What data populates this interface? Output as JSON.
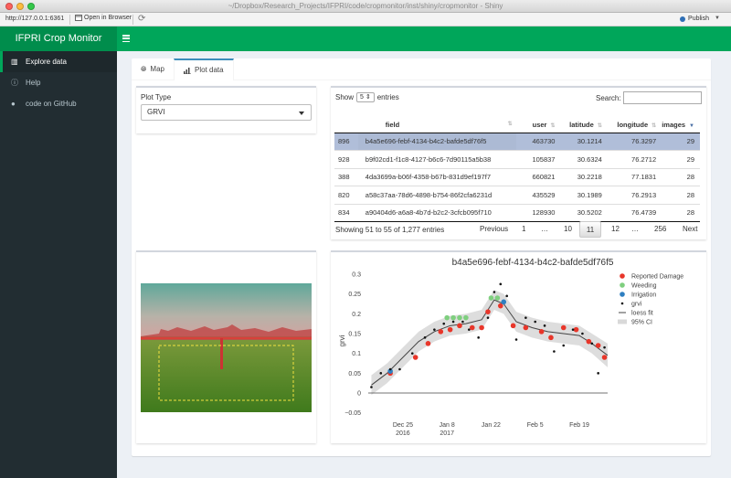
{
  "window": {
    "title": "~/Dropbox/Research_Projects/IFPRI/code/cropmonitor/inst/shiny/cropmonitor - Shiny",
    "url": "http://127.0.0.1:6361",
    "open_in_browser": "Open in Browser",
    "publish": "Publish"
  },
  "header": {
    "logo": "IFPRI Crop Monitor"
  },
  "sidebar": {
    "items": [
      {
        "label": "Explore data",
        "icon": "bar-chart-icon"
      },
      {
        "label": "Help",
        "icon": "info-circle-icon"
      },
      {
        "label": "code on GitHub",
        "icon": "github-icon"
      }
    ]
  },
  "tabs": [
    {
      "label": "Map",
      "icon": "globe-icon"
    },
    {
      "label": "Plot data",
      "icon": "bar-chart-icon"
    }
  ],
  "plot_type": {
    "label": "Plot Type",
    "value": "GRVI"
  },
  "table": {
    "show_label": "Show",
    "length_value": "5",
    "entries_label": "entries",
    "search_label": "Search:",
    "search_value": "",
    "headers": [
      "",
      "field",
      "user",
      "latitude",
      "longitude",
      "images"
    ],
    "rows": [
      [
        "896",
        "b4a5e696-febf-4134-b4c2-bafde5df76f5",
        "463730",
        "30.1214",
        "76.3297",
        "29"
      ],
      [
        "928",
        "b9f02cd1-f1c8-4127-b6c6-7d90115a5b38",
        "105837",
        "30.6324",
        "76.2712",
        "29"
      ],
      [
        "388",
        "4da3699a-b06f-4358-b67b-831d9ef197f7",
        "660821",
        "30.2218",
        "77.1831",
        "28"
      ],
      [
        "820",
        "a58c37aa-78d6-4898-b754-86f2cfa6231d",
        "435529",
        "30.1989",
        "76.2913",
        "28"
      ],
      [
        "834",
        "a90404d6-a6a8-4b7d-b2c2-3cfcb095f710",
        "128930",
        "30.5202",
        "76.4739",
        "28"
      ]
    ],
    "info": "Showing 51 to 55 of 1,277 entries",
    "pagination": [
      "Previous",
      "1",
      "…",
      "10",
      "11",
      "12",
      "…",
      "256",
      "Next"
    ],
    "current_page": "11"
  },
  "colors": {
    "header_green": "#00a65a",
    "logo_green": "#008d4c",
    "sidebar_dark": "#222d32",
    "selected_row": "#b0bed9",
    "reported_damage": "#e8362a",
    "weeding": "#7fcf7f",
    "irrigation": "#2f7fc1",
    "grvi": "#111111",
    "loess": "#444444",
    "ci_band": "#d9d9d9"
  },
  "chart_data": {
    "type": "scatter",
    "title": "b4a5e696-febf-4134-b4c2-bafde5df76f5",
    "xlabel": "",
    "ylabel": "grvi",
    "x_ticks": [
      "Dec 25\n2016",
      "Jan 8\n2017",
      "Jan 22",
      "Feb 5",
      "Feb 19"
    ],
    "x_tick_dates": [
      "2016-12-25",
      "2017-01-08",
      "2017-01-22",
      "2017-02-05",
      "2017-02-19"
    ],
    "x_range": [
      "2016-12-14",
      "2017-02-28"
    ],
    "y_ticks": [
      -0.05,
      0,
      0.05,
      0.1,
      0.15,
      0.2,
      0.25,
      0.3
    ],
    "ylim": [
      -0.06,
      0.3
    ],
    "legend": [
      "Reported Damage",
      "Weeding",
      "Irrigation",
      "grvi",
      "loess fit",
      "95% CI"
    ],
    "legend_placement": "right",
    "series": [
      {
        "name": "Reported Damage",
        "marker": "circle",
        "points": [
          [
            "2016-12-21",
            0.05
          ],
          [
            "2016-12-29",
            0.09
          ],
          [
            "2017-01-02",
            0.125
          ],
          [
            "2017-01-06",
            0.155
          ],
          [
            "2017-01-09",
            0.16
          ],
          [
            "2017-01-12",
            0.17
          ],
          [
            "2017-01-16",
            0.165
          ],
          [
            "2017-01-19",
            0.165
          ],
          [
            "2017-01-21",
            0.205
          ],
          [
            "2017-01-25",
            0.22
          ],
          [
            "2017-01-29",
            0.17
          ],
          [
            "2017-02-02",
            0.165
          ],
          [
            "2017-02-07",
            0.155
          ],
          [
            "2017-02-10",
            0.14
          ],
          [
            "2017-02-14",
            0.165
          ],
          [
            "2017-02-18",
            0.16
          ],
          [
            "2017-02-22",
            0.13
          ],
          [
            "2017-02-25",
            0.12
          ],
          [
            "2017-02-27",
            0.09
          ]
        ]
      },
      {
        "name": "Weeding",
        "marker": "circle",
        "points": [
          [
            "2017-01-08",
            0.19
          ],
          [
            "2017-01-10",
            0.19
          ],
          [
            "2017-01-12",
            0.19
          ],
          [
            "2017-01-14",
            0.19
          ],
          [
            "2017-01-22",
            0.24
          ],
          [
            "2017-01-24",
            0.24
          ]
        ]
      },
      {
        "name": "Irrigation",
        "marker": "circle",
        "points": [
          [
            "2016-12-21",
            0.055
          ],
          [
            "2017-01-26",
            0.23
          ]
        ]
      },
      {
        "name": "grvi",
        "marker": "dot",
        "points": [
          [
            "2016-12-15",
            0.015
          ],
          [
            "2016-12-18",
            0.05
          ],
          [
            "2016-12-21",
            0.06
          ],
          [
            "2016-12-24",
            0.06
          ],
          [
            "2016-12-28",
            0.1
          ],
          [
            "2017-01-01",
            0.14
          ],
          [
            "2017-01-04",
            0.16
          ],
          [
            "2017-01-07",
            0.175
          ],
          [
            "2017-01-10",
            0.18
          ],
          [
            "2017-01-13",
            0.18
          ],
          [
            "2017-01-15",
            0.16
          ],
          [
            "2017-01-18",
            0.14
          ],
          [
            "2017-01-21",
            0.19
          ],
          [
            "2017-01-23",
            0.255
          ],
          [
            "2017-01-25",
            0.275
          ],
          [
            "2017-01-27",
            0.245
          ],
          [
            "2017-01-30",
            0.135
          ],
          [
            "2017-02-02",
            0.19
          ],
          [
            "2017-02-05",
            0.18
          ],
          [
            "2017-02-08",
            0.17
          ],
          [
            "2017-02-11",
            0.105
          ],
          [
            "2017-02-14",
            0.12
          ],
          [
            "2017-02-17",
            0.16
          ],
          [
            "2017-02-20",
            0.15
          ],
          [
            "2017-02-23",
            0.125
          ],
          [
            "2017-02-25",
            0.05
          ],
          [
            "2017-02-27",
            0.115
          ]
        ]
      },
      {
        "name": "loess fit",
        "marker": "line",
        "points": [
          [
            "2016-12-15",
            0.02
          ],
          [
            "2016-12-20",
            0.05
          ],
          [
            "2016-12-25",
            0.09
          ],
          [
            "2016-12-30",
            0.13
          ],
          [
            "2017-01-04",
            0.155
          ],
          [
            "2017-01-09",
            0.17
          ],
          [
            "2017-01-14",
            0.175
          ],
          [
            "2017-01-19",
            0.185
          ],
          [
            "2017-01-23",
            0.235
          ],
          [
            "2017-01-26",
            0.225
          ],
          [
            "2017-01-30",
            0.18
          ],
          [
            "2017-02-04",
            0.165
          ],
          [
            "2017-02-09",
            0.155
          ],
          [
            "2017-02-14",
            0.15
          ],
          [
            "2017-02-19",
            0.145
          ],
          [
            "2017-02-23",
            0.125
          ],
          [
            "2017-02-28",
            0.095
          ]
        ]
      },
      {
        "name": "95% CI",
        "marker": "band",
        "points": [
          [
            "2016-12-15",
            -0.005,
            0.045
          ],
          [
            "2016-12-20",
            0.025,
            0.075
          ],
          [
            "2016-12-25",
            0.065,
            0.115
          ],
          [
            "2016-12-30",
            0.105,
            0.155
          ],
          [
            "2017-01-04",
            0.13,
            0.18
          ],
          [
            "2017-01-09",
            0.145,
            0.195
          ],
          [
            "2017-01-14",
            0.15,
            0.2
          ],
          [
            "2017-01-19",
            0.16,
            0.21
          ],
          [
            "2017-01-23",
            0.21,
            0.26
          ],
          [
            "2017-01-26",
            0.2,
            0.25
          ],
          [
            "2017-01-30",
            0.155,
            0.205
          ],
          [
            "2017-02-04",
            0.14,
            0.19
          ],
          [
            "2017-02-09",
            0.13,
            0.18
          ],
          [
            "2017-02-14",
            0.125,
            0.175
          ],
          [
            "2017-02-19",
            0.12,
            0.17
          ],
          [
            "2017-02-23",
            0.1,
            0.15
          ],
          [
            "2017-02-28",
            0.065,
            0.125
          ]
        ]
      }
    ]
  }
}
